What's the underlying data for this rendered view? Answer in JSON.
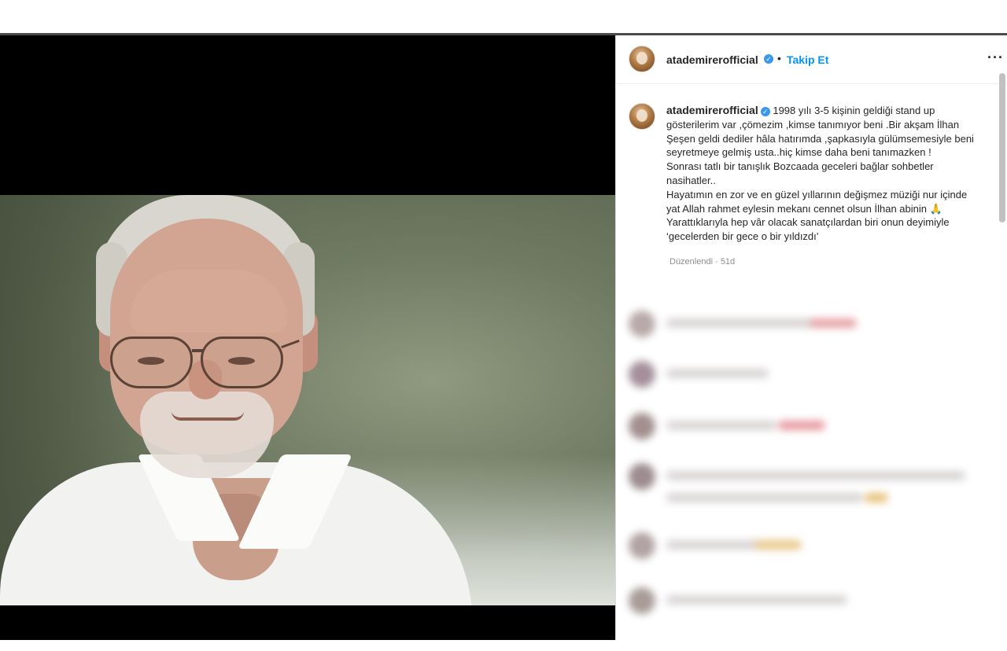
{
  "post": {
    "username": "atademirerofficial",
    "verified_mark": "✓",
    "separator": "•",
    "follow_label": "Takip Et",
    "more_label": "···"
  },
  "caption": {
    "username": "atademirerofficial",
    "lines": [
      "1998 yılı 3-5 kişinin geldiği stand up",
      "gösterilerim var ,çömezim ,kimse tanımıyor beni .Bir akşam İlhan",
      "Şeşen geldi dediler hâla hatırımda ,şapkasıyla gülümsemesiyle beni",
      "seyretmeye gelmiş usta..hiç kimse daha beni tanımazken !",
      "Sonrası tatlı bir tanışlık Bozcaada geceleri bağlar sohbetler",
      "nasihatler..",
      "Hayatımın en zor ve en güzel yıllarının değişmez müziği nur içinde",
      "yat Allah rahmet eylesin mekanı cennet olsun İlhan abinin 🙏",
      "Yarattıklarıyla hep vâr olacak sanatçılardan biri onun deyimiyle",
      "‘gecelerden bir gece o bir yıldızdı’"
    ],
    "edited": "Düzenlendi · 51d"
  },
  "icons": {
    "avatar": "profile-avatar",
    "verified": "verified-badge-icon",
    "more": "more-options-icon"
  },
  "colors": {
    "follow": "#0095f6",
    "verified": "#3897f0",
    "media_bg": "#000000"
  }
}
